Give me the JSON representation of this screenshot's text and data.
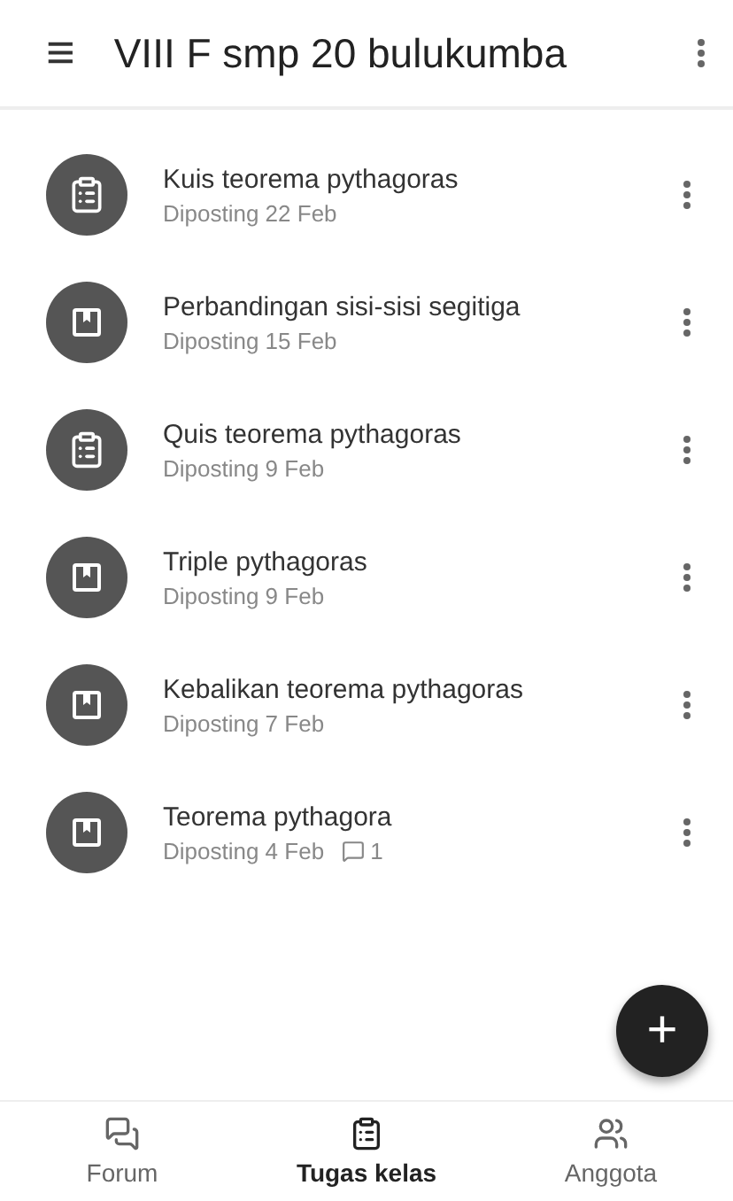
{
  "header": {
    "menu_icon": "≡",
    "title": "VIII F smp 20 bulukumba"
  },
  "assignments": [
    {
      "kind": "quiz",
      "title": "Kuis teorema pythagoras",
      "posted": "Diposting 22 Feb"
    },
    {
      "kind": "material",
      "title": "Perbandingan sisi-sisi segitiga",
      "posted": "Diposting 15 Feb"
    },
    {
      "kind": "quiz",
      "title": "Quis teorema pythagoras",
      "posted": "Diposting 9 Feb"
    },
    {
      "kind": "material",
      "title": "Triple pythagoras",
      "posted": "Diposting 9 Feb"
    },
    {
      "kind": "material",
      "title": "Kebalikan teorema pythagoras",
      "posted": "Diposting 7 Feb"
    },
    {
      "kind": "material",
      "title": "Teorema pythagora",
      "posted": "Diposting 4 Feb",
      "comments": "1"
    }
  ],
  "fab": {
    "label": "+"
  },
  "bottom_nav": [
    {
      "kind": "forum",
      "label": "Forum",
      "selected": false
    },
    {
      "kind": "classwork",
      "label": "Tugas kelas",
      "selected": true
    },
    {
      "kind": "members",
      "label": "Anggota",
      "selected": false
    }
  ]
}
